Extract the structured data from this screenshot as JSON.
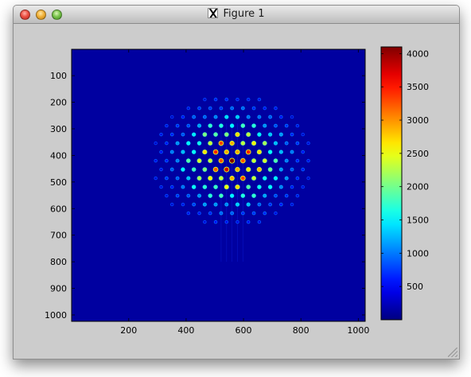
{
  "window": {
    "title": "Figure 1",
    "controls": {
      "close": "close-button",
      "minimize": "minimize-button",
      "zoom": "zoom-button"
    },
    "title_icon": "x11-icon"
  },
  "colors": {
    "background": "#0000a0",
    "window_bg": "#cccccc",
    "jet_colormap": [
      "#00008f",
      "#0000ff",
      "#0080ff",
      "#00ffff",
      "#80ff80",
      "#ffff00",
      "#ff8000",
      "#ff0000",
      "#800000"
    ]
  },
  "chart_data": {
    "type": "heatmap",
    "title": "",
    "xlabel": "",
    "ylabel": "",
    "xlim": [
      1,
      1024
    ],
    "ylim": [
      1024,
      1
    ],
    "x_ticks": [
      200,
      400,
      600,
      800,
      1000
    ],
    "y_ticks": [
      100,
      200,
      300,
      400,
      500,
      600,
      700,
      800,
      900,
      1000
    ],
    "pattern": {
      "description": "hexagonal lattice of bright spots",
      "center": [
        560,
        420
      ],
      "lattice_spacing": 38,
      "envelope_radius_x": 260,
      "envelope_radius_y": 240,
      "peak_value": 4100,
      "background_value": 0
    },
    "colorbar": {
      "range": [
        0,
        4100
      ],
      "ticks": [
        500,
        1000,
        1500,
        2000,
        2500,
        3000,
        3500,
        4000
      ]
    }
  }
}
